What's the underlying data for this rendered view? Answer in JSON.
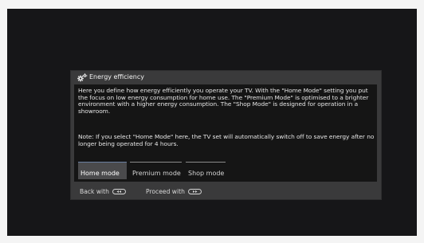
{
  "dialog": {
    "title": "Energy efficiency",
    "icon": "gear-icon",
    "description": "Here you define how energy efficiently you operate your TV. With the  \"Home Mode\" setting you put the focus on low energy consumption for home use. The \"Premium Mode\" is optimised to a brighter environment with a higher energy consumption. The \"Shop Mode\" is designed for operation in a showroom.",
    "note": "Note: If you select  \"Home Mode\" here, the TV set will automatically switch off to save energy after no longer being operated for 4 hours."
  },
  "modes": [
    {
      "label": "Home mode",
      "selected": true
    },
    {
      "label": "Premium mode",
      "selected": false
    },
    {
      "label": "Shop mode",
      "selected": false
    }
  ],
  "footer": {
    "back_label": "Back with",
    "back_key_icon": "rewind-key-icon",
    "proceed_label": "Proceed with",
    "proceed_key_icon": "fast-forward-key-icon"
  },
  "colors": {
    "background": "#161618",
    "dialog": "#3a3a3b",
    "panel": "#151515",
    "selected_tab": "#4a4a4c"
  }
}
